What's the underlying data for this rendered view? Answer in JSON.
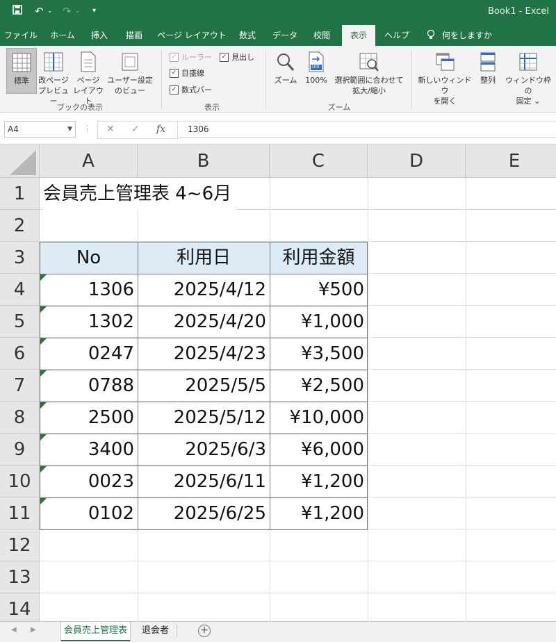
{
  "window": {
    "title": "Book1  -  Excel"
  },
  "ribbon": {
    "tabs": [
      "ファイル",
      "ホーム",
      "挿入",
      "描画",
      "ページ レイアウト",
      "数式",
      "データ",
      "校閲",
      "表示",
      "ヘルプ"
    ],
    "active_tab": "表示",
    "tell_me": "何をしますか",
    "workbook_views": {
      "label": "ブックの表示",
      "normal": "標準",
      "page_break": [
        "改ページ",
        "プレビュー"
      ],
      "page_layout": [
        "ページ",
        "レイアウト"
      ],
      "custom": [
        "ユーザー設定",
        "のビュー"
      ]
    },
    "show": {
      "label": "表示",
      "ruler": "ルーラー",
      "headings": "見出し",
      "gridlines": "目盛線",
      "formula_bar": "数式バー"
    },
    "zoom": {
      "label": "ズーム",
      "zoom": "ズーム",
      "hundred": "100%",
      "hundred_icon": "100",
      "selection": [
        "選択範囲に合わせて",
        "拡大/縮小"
      ]
    },
    "window_group": {
      "new_window": [
        "新しいウィンドウ",
        "を開く"
      ],
      "arrange": "整列",
      "freeze": [
        "ウィンドウ枠の",
        "固定 ⌄"
      ]
    }
  },
  "formula_bar": {
    "name_box": "A4",
    "content": "1306"
  },
  "grid": {
    "columns": [
      "A",
      "B",
      "C",
      "D",
      "E"
    ],
    "rows": [
      "1",
      "2",
      "3",
      "4",
      "5",
      "6",
      "7",
      "8",
      "9",
      "10",
      "11",
      "12",
      "13",
      "14"
    ],
    "title": "会員売上管理表 4~6月",
    "headers": [
      "No",
      "利用日",
      "利用金額"
    ],
    "records": [
      [
        "1306",
        "2025/4/12",
        "¥500"
      ],
      [
        "1302",
        "2025/4/20",
        "¥1,000"
      ],
      [
        "0247",
        "2025/4/23",
        "¥3,500"
      ],
      [
        "0788",
        "2025/5/5",
        "¥2,500"
      ],
      [
        "2500",
        "2025/5/12",
        "¥10,000"
      ],
      [
        "3400",
        "2025/6/3",
        "¥6,000"
      ],
      [
        "0023",
        "2025/6/11",
        "¥1,200"
      ],
      [
        "0102",
        "2025/6/25",
        "¥1,200"
      ]
    ]
  },
  "sheets": {
    "tabs": [
      "会員売上管理表",
      "退会者"
    ],
    "active": "会員売上管理表"
  },
  "colors": {
    "excel_green": "#217346",
    "header_fill": "#ddebf7",
    "error_triangle": "#1f7a34"
  }
}
